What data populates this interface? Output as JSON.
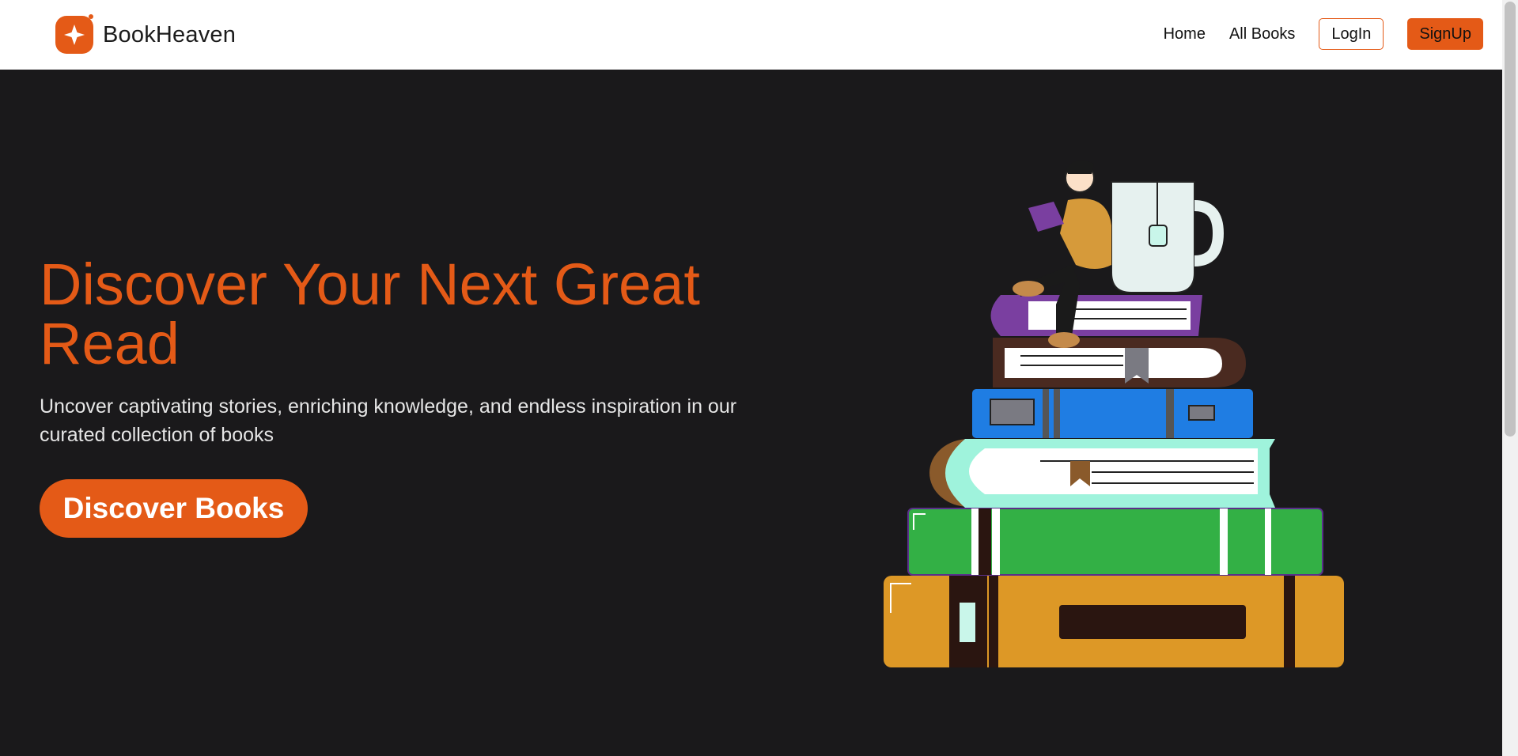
{
  "brand": {
    "name": "BookHeaven",
    "color": "#e45a17"
  },
  "nav": {
    "home": "Home",
    "all_books": "All Books",
    "login": "LogIn",
    "signup": "SignUp"
  },
  "hero": {
    "title": "Discover Your Next Great Read",
    "subtitle": "Uncover captivating stories, enriching knowledge, and endless inspiration in our curated collection of books",
    "cta": "Discover Books",
    "illustration": "reader-on-book-stack-illustration"
  },
  "colors": {
    "background": "#1a191b",
    "accent": "#e45a17",
    "navbar": "#ffffff"
  }
}
